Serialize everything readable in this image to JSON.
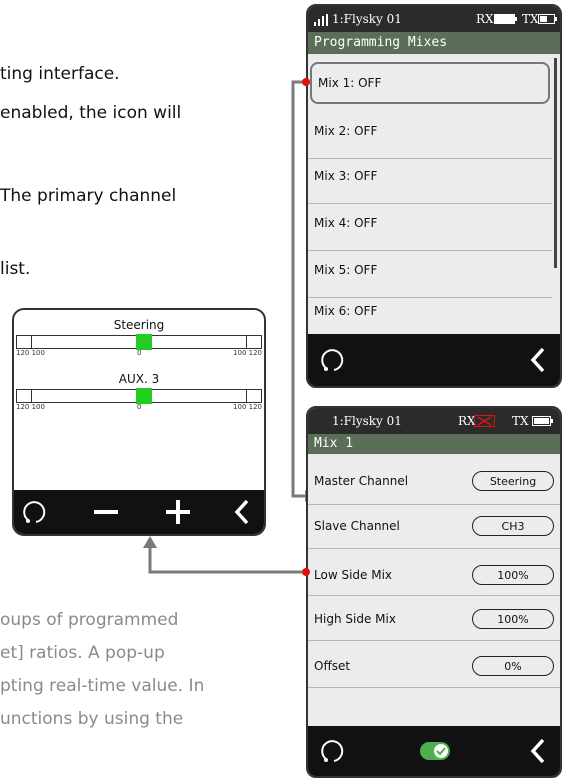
{
  "doc": {
    "line1": "ting interface.",
    "line2": "enabled, the icon will",
    "line3": "The primary channel",
    "line4": "list.",
    "gray1": "oups of programmed",
    "gray2": "et] ratios. A pop-up",
    "gray3": "pting real-time value. In",
    "gray4": "unctions by using the"
  },
  "mixes_screen": {
    "status_title": "1:Flysky 01",
    "rx_label": "RX",
    "tx_label": "TX",
    "title": "Programming Mixes",
    "items": [
      "Mix 1: OFF",
      "Mix 2: OFF",
      "Mix 3: OFF",
      "Mix 4: OFF",
      "Mix 5: OFF",
      "Mix 6: OFF"
    ]
  },
  "monitor_screen": {
    "channel1": "Steering",
    "channel2": "AUX. 3",
    "channel1_value": 0,
    "channel2_value": 0,
    "scale_left": "120 100",
    "scale_mid": "0",
    "scale_right": "100 120"
  },
  "mix_detail_screen": {
    "status_title": "1:Flysky 01",
    "rx_label": "RX",
    "tx_label": "TX",
    "title": "Mix 1",
    "params": [
      {
        "label": "Master Channel",
        "value": "Steering"
      },
      {
        "label": "Slave Channel",
        "value": "CH3"
      },
      {
        "label": "Low Side Mix",
        "value": "100%"
      },
      {
        "label": "High Side Mix",
        "value": "100%"
      },
      {
        "label": "Offset",
        "value": "0%"
      }
    ],
    "toggle_on": true
  },
  "colors": {
    "title_bar": "#5b6e58",
    "bar_fill": "#22cc22",
    "toggle": "#4caf50",
    "pointer_dot": "#e01010",
    "connector": "#7a7a7a"
  },
  "icons": [
    "signal-icon",
    "battery-icon",
    "rx-error-icon",
    "rotate-icon",
    "minus-icon",
    "plus-icon",
    "back-icon",
    "toggle-icon"
  ]
}
